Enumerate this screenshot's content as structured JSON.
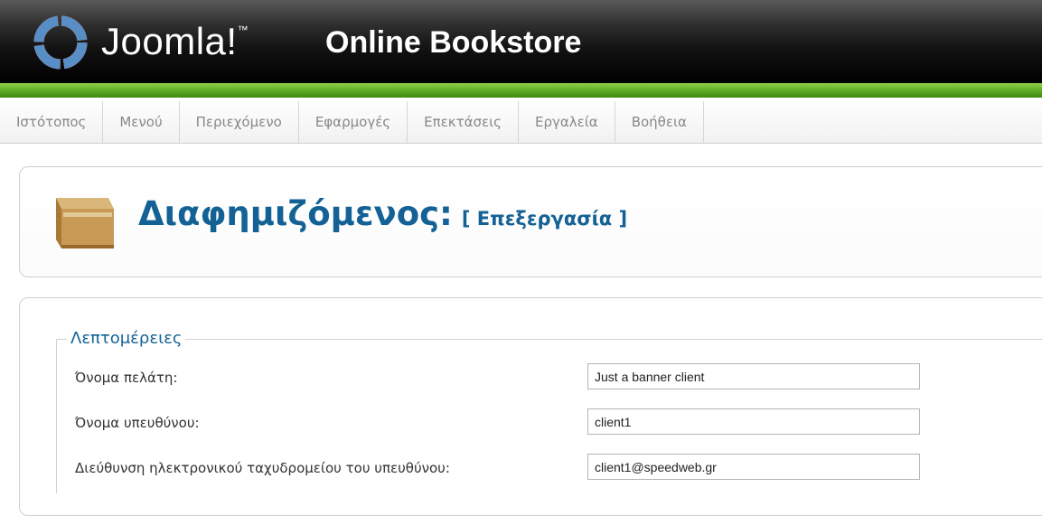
{
  "header": {
    "brand": "Joomla!",
    "site_title": "Online Bookstore",
    "colors": {
      "header_bg": "#000000",
      "accent_stripe": "#5da823"
    }
  },
  "menu": {
    "items": [
      {
        "label": "Ιστότοπος"
      },
      {
        "label": "Μενού"
      },
      {
        "label": "Περιεχόμενο"
      },
      {
        "label": "Εφαρμογές"
      },
      {
        "label": "Επεκτάσεις"
      },
      {
        "label": "Εργαλεία"
      },
      {
        "label": "Βοήθεια"
      }
    ]
  },
  "toolbar": {
    "icon": "banner-client-box-icon",
    "title": "Διαφημιζόμενος:",
    "subtitle": "[ Επεξεργασία ]",
    "title_color": "#146295"
  },
  "details": {
    "legend": "Λεπτομέρειες",
    "fields": [
      {
        "label": "Όνομα πελάτη:",
        "value": "Just a banner client"
      },
      {
        "label": "Όνομα υπευθύνου:",
        "value": "client1"
      },
      {
        "label": "Διεύθυνση ηλεκτρονικού ταχυδρομείου του υπευθύνου:",
        "value": "client1@speedweb.gr"
      }
    ]
  }
}
